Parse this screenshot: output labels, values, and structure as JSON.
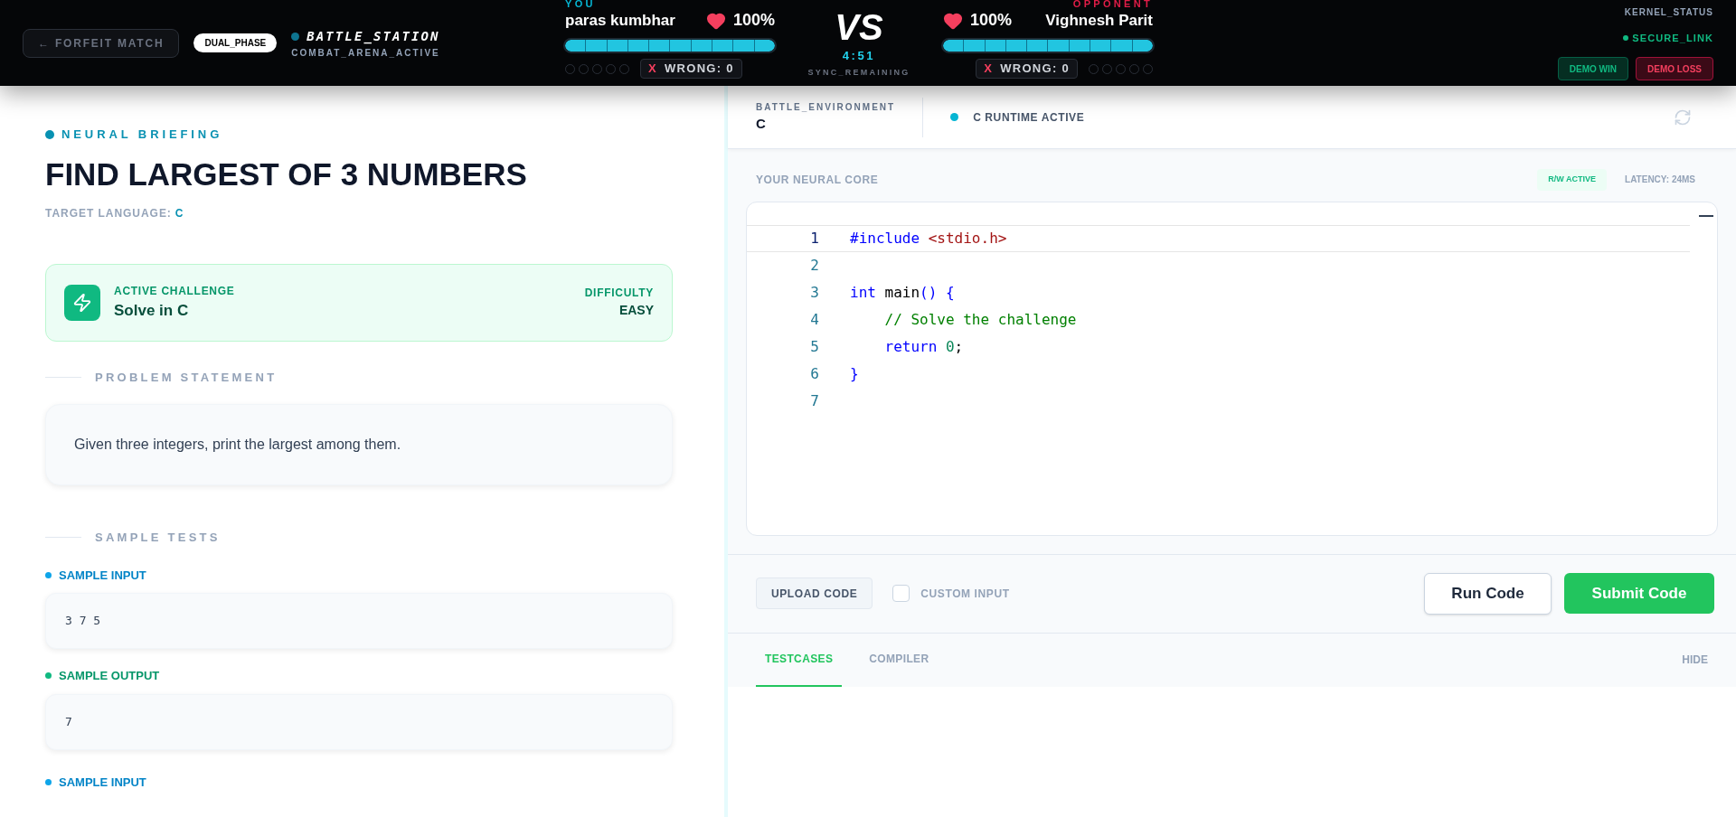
{
  "header": {
    "forfeit": "← FORFEIT MATCH",
    "phase": "DUAL_PHASE",
    "station": "BATTLE_STATION",
    "arena": "COMBAT_ARENA_ACTIVE",
    "players": [
      {
        "role": "YOU",
        "name": "paras kumbhar",
        "health": "100%",
        "level": 1,
        "wrong_mark": "X",
        "wrong": "WRONG: 0",
        "dots": [
          {
            "filled": false
          },
          {
            "filled": false
          },
          {
            "filled": false
          },
          {
            "filled": false
          },
          {
            "filled": false
          }
        ]
      },
      {
        "role": "OPPONENT",
        "name": "Vighnesh Parit",
        "health": "100%",
        "level": 1,
        "wrong_mark": "X",
        "wrong": "WRONG: 0",
        "dots": [
          {
            "filled": false
          },
          {
            "filled": false
          },
          {
            "filled": false
          },
          {
            "filled": false
          },
          {
            "filled": false
          }
        ]
      }
    ],
    "vs": "VS",
    "timer": "4:51",
    "timer_label": "SYNC_REMAINING",
    "kernel_label": "KERNEL_STATUS",
    "kernel_status": "SECURE_LINK",
    "demo_buttons": [
      {
        "kind": "win",
        "label": "DEMO WIN"
      },
      {
        "kind": "loss",
        "label": "DEMO LOSS"
      }
    ]
  },
  "briefing": {
    "eyebrow": "NEURAL BRIEFING",
    "title": "FIND LARGEST OF 3 NUMBERS",
    "language_label": "TARGET LANGUAGE:",
    "language": "C",
    "challenge": {
      "label": "ACTIVE CHALLENGE",
      "value": "Solve in C",
      "difficulty_label": "DIFFICULTY",
      "difficulty": "EASY"
    },
    "statement_heading": "PROBLEM STATEMENT",
    "statement": "Given three integers, print the largest among them.",
    "tests_heading": "SAMPLE TESTS",
    "samples": [
      {
        "kind": "input",
        "label": "SAMPLE INPUT",
        "value": "3 7 5"
      },
      {
        "kind": "output",
        "label": "SAMPLE OUTPUT",
        "value": "7"
      },
      {
        "kind": "input",
        "label": "SAMPLE INPUT"
      }
    ]
  },
  "editor": {
    "env_label": "BATTLE_ENVIRONMENT",
    "env": "C",
    "runtime": "C RUNTIME ACTIVE",
    "core_label": "YOUR NEURAL CORE",
    "rw": "R/W ACTIVE",
    "latency": "LATENCY: 24MS",
    "lines": [
      {
        "number": "1",
        "selected": true,
        "tokens": [
          {
            "kind": "directive",
            "text": "#include "
          },
          {
            "kind": "string",
            "text": "<stdio.h>"
          }
        ]
      },
      {
        "number": "2",
        "selected": false
      },
      {
        "number": "3",
        "selected": false,
        "tokens": [
          {
            "kind": "keyword",
            "text": "int"
          },
          {
            "kind": "plain",
            "text": " main"
          },
          {
            "kind": "keyword",
            "text": "() {"
          }
        ]
      },
      {
        "number": "4",
        "selected": false,
        "tokens": [
          {
            "kind": "comment",
            "text": "    // Solve the challenge"
          }
        ]
      },
      {
        "number": "5",
        "selected": false,
        "tokens": [
          {
            "kind": "keyword",
            "text": "    return "
          },
          {
            "kind": "number",
            "text": "0"
          },
          {
            "kind": "plain",
            "text": ";"
          }
        ]
      },
      {
        "number": "6",
        "selected": false,
        "tokens": [
          {
            "kind": "keyword",
            "text": "}"
          }
        ]
      },
      {
        "number": "7",
        "selected": false
      }
    ],
    "upload": "UPLOAD CODE",
    "custom_input": {
      "label": "CUSTOM INPUT",
      "checked": false
    },
    "run": "Run Code",
    "submit": "Submit Code",
    "tabs": [
      {
        "label": "TESTCASES",
        "selected": true
      },
      {
        "label": "COMPILER",
        "selected": false
      }
    ],
    "hide": "HIDE"
  }
}
